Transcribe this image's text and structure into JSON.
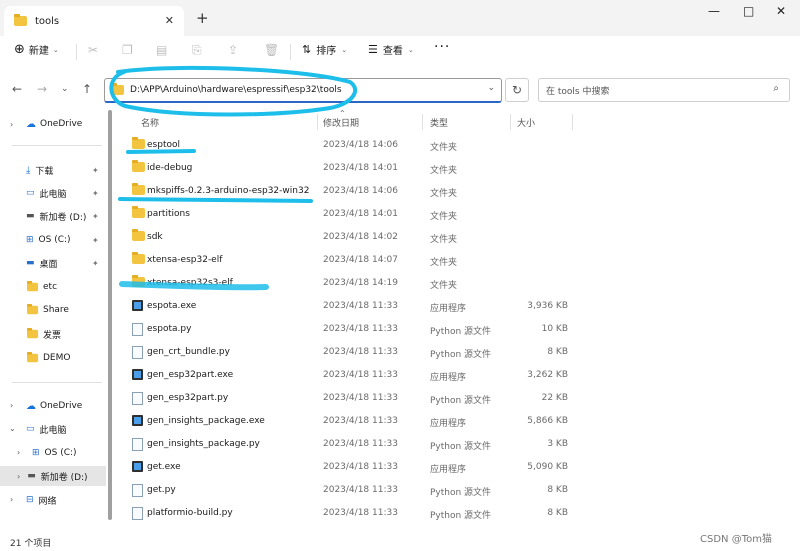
{
  "window": {
    "tab_title": "tools",
    "new_tab": "+",
    "close_tab": "✕",
    "controls": [
      "—",
      "□",
      "✕"
    ]
  },
  "toolbar": {
    "new_label": "新建",
    "sort_label": "排序",
    "view_label": "查看",
    "more_label": "···"
  },
  "nav": {
    "address": "D:\\APP\\Arduino\\hardware\\espressif\\esp32\\tools",
    "search_placeholder": "在 tools 中搜索"
  },
  "sidebar": {
    "items": [
      {
        "label": "OneDrive"
      },
      {
        "label": "下载"
      },
      {
        "label": "此电脑"
      },
      {
        "label": "新加卷 (D:)"
      },
      {
        "label": "OS (C:)"
      },
      {
        "label": "桌面"
      },
      {
        "label": "etc"
      },
      {
        "label": "Share"
      },
      {
        "label": "发票"
      },
      {
        "label": "DEMO"
      },
      {
        "label": "OneDrive"
      },
      {
        "label": "此电脑"
      },
      {
        "label": "OS (C:)"
      },
      {
        "label": "新加卷 (D:)"
      },
      {
        "label": "网络"
      }
    ]
  },
  "columns": {
    "name": "名称",
    "date": "修改日期",
    "type": "类型",
    "size": "大小"
  },
  "files": [
    {
      "name": "esptool",
      "date": "2023/4/18 14:06",
      "type": "文件夹",
      "size": "",
      "icon": "folder"
    },
    {
      "name": "ide-debug",
      "date": "2023/4/18 14:01",
      "type": "文件夹",
      "size": "",
      "icon": "folder"
    },
    {
      "name": "mkspiffs-0.2.3-arduino-esp32-win32",
      "date": "2023/4/18 14:06",
      "type": "文件夹",
      "size": "",
      "icon": "folder"
    },
    {
      "name": "partitions",
      "date": "2023/4/18 14:01",
      "type": "文件夹",
      "size": "",
      "icon": "folder"
    },
    {
      "name": "sdk",
      "date": "2023/4/18 14:02",
      "type": "文件夹",
      "size": "",
      "icon": "folder"
    },
    {
      "name": "xtensa-esp32-elf",
      "date": "2023/4/18 14:07",
      "type": "文件夹",
      "size": "",
      "icon": "folder"
    },
    {
      "name": "xtensa-esp32s3-elf",
      "date": "2023/4/18 14:19",
      "type": "文件夹",
      "size": "",
      "icon": "folder"
    },
    {
      "name": "espota.exe",
      "date": "2023/4/18 11:33",
      "type": "应用程序",
      "size": "3,936 KB",
      "icon": "exe"
    },
    {
      "name": "espota.py",
      "date": "2023/4/18 11:33",
      "type": "Python 源文件",
      "size": "10 KB",
      "icon": "py"
    },
    {
      "name": "gen_crt_bundle.py",
      "date": "2023/4/18 11:33",
      "type": "Python 源文件",
      "size": "8 KB",
      "icon": "py"
    },
    {
      "name": "gen_esp32part.exe",
      "date": "2023/4/18 11:33",
      "type": "应用程序",
      "size": "3,262 KB",
      "icon": "exe"
    },
    {
      "name": "gen_esp32part.py",
      "date": "2023/4/18 11:33",
      "type": "Python 源文件",
      "size": "22 KB",
      "icon": "py"
    },
    {
      "name": "gen_insights_package.exe",
      "date": "2023/4/18 11:33",
      "type": "应用程序",
      "size": "5,866 KB",
      "icon": "exe"
    },
    {
      "name": "gen_insights_package.py",
      "date": "2023/4/18 11:33",
      "type": "Python 源文件",
      "size": "3 KB",
      "icon": "py"
    },
    {
      "name": "get.exe",
      "date": "2023/4/18 11:33",
      "type": "应用程序",
      "size": "5,090 KB",
      "icon": "exe"
    },
    {
      "name": "get.py",
      "date": "2023/4/18 11:33",
      "type": "Python 源文件",
      "size": "8 KB",
      "icon": "py"
    },
    {
      "name": "platformio-build.py",
      "date": "2023/4/18 11:33",
      "type": "Python 源文件",
      "size": "8 KB",
      "icon": "py"
    }
  ],
  "status": {
    "count": "21 个项目"
  },
  "watermark": "CSDN @Tom猫",
  "colors": {
    "annotation_highlight": "#1ebeea"
  }
}
